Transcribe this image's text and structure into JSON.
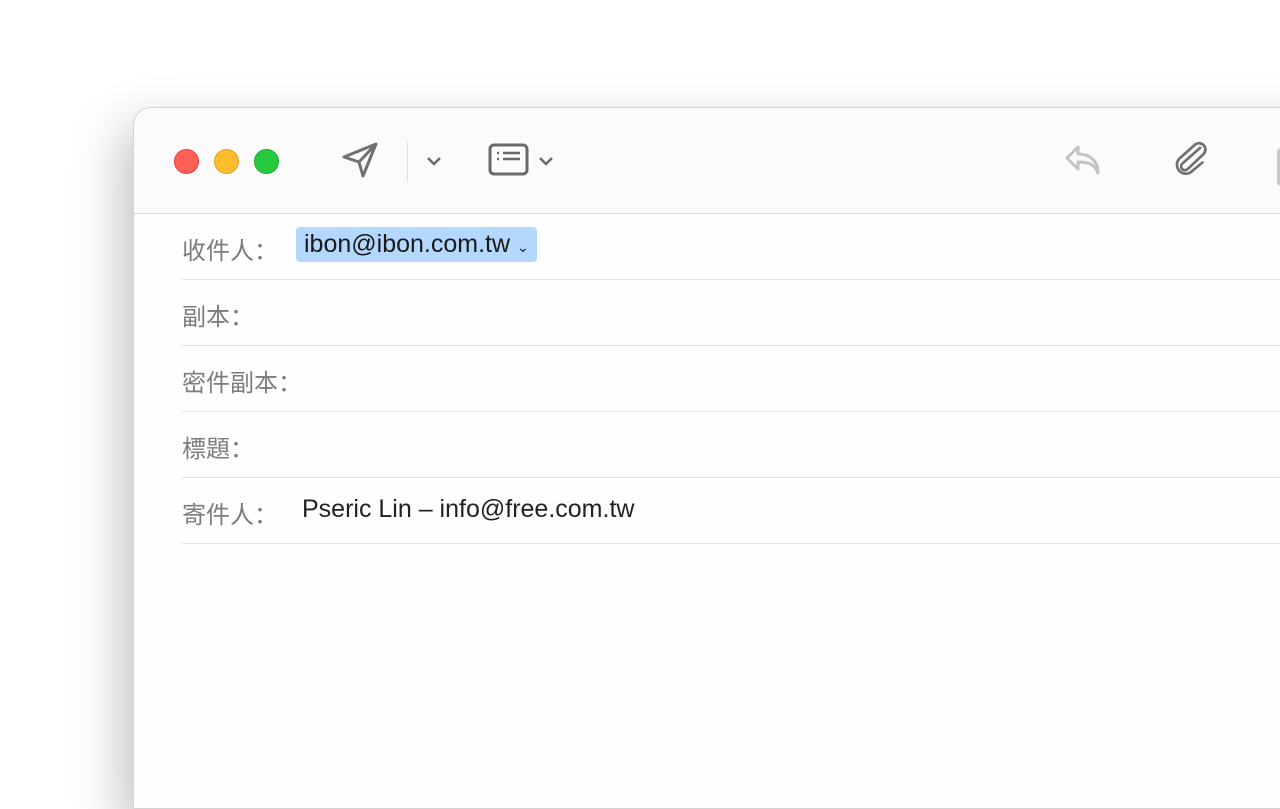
{
  "compose": {
    "to_label": "收件人：",
    "to_value": "ibon@ibon.com.tw",
    "cc_label": "副本：",
    "bcc_label": "密件副本：",
    "subject_label": "標題：",
    "from_label": "寄件人：",
    "from_value": "Pseric Lin – info@free.com.tw"
  },
  "icons": [
    "close",
    "minimize",
    "zoom",
    "send",
    "chevron-down",
    "header-fields",
    "reply",
    "paperclip"
  ],
  "colors": {
    "close": "#fe5f57",
    "minimize": "#febc2e",
    "zoom": "#28c840",
    "selection": "#b3d7fd"
  }
}
